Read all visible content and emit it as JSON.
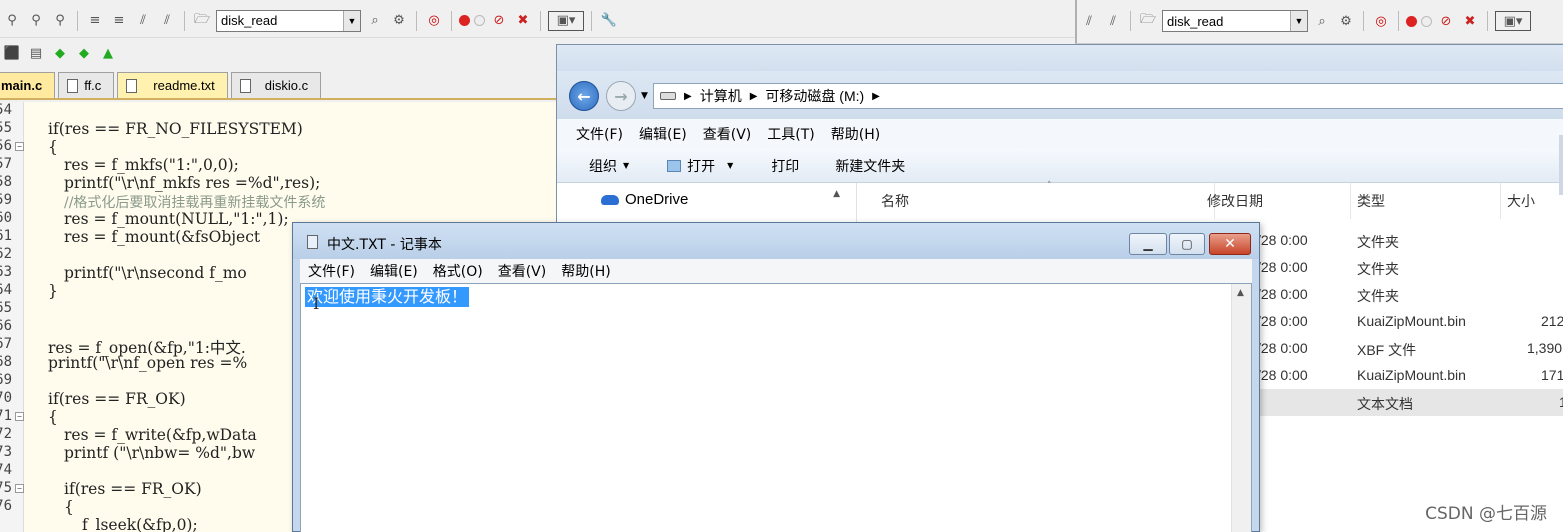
{
  "ide": {
    "toolbar": {
      "target_name": "disk_read"
    },
    "tabs": [
      {
        "label": "main.c"
      },
      {
        "label": "ff.c"
      },
      {
        "label": "readme.txt"
      },
      {
        "label": "diskio.c"
      }
    ],
    "gutter_numbers": [
      "54",
      "55",
      "56",
      "57",
      "58",
      "59",
      "60",
      "61",
      "62",
      "63",
      "64",
      "65",
      "66",
      "67",
      "68",
      "69",
      "70",
      "71",
      "72",
      "73",
      "74",
      "75",
      "76"
    ],
    "code_lines": [
      "if(res == FR_NO_FILESYSTEM)",
      "{",
      "res = f_mkfs(\"1:\",0,0);",
      "printf(\"\\r\\nf_mkfs res =%d\",res);",
      "//格式化后要取消挂载再重新挂载文件系统",
      "res = f_mount(NULL,\"1:\",1);",
      "res = f_mount(&fsObject",
      "printf(\"\\r\\nsecond f_mo",
      "}",
      "res = f_open(&fp,\"1:中文.",
      "printf(\"\\r\\nf_open res =%",
      "if(res == FR_OK)",
      "{",
      "res = f_write(&fp,wData",
      "printf (\"\\r\\nbw= %d\",bw",
      "if(res == FR_OK)",
      "{",
      "f_lseek(&fp,0);"
    ]
  },
  "ide2": {
    "target_name": "disk_read"
  },
  "explorer": {
    "breadcrumb": [
      "计算机",
      "可移动磁盘 (M:)"
    ],
    "menu": [
      "文件(F)",
      "编辑(E)",
      "查看(V)",
      "工具(T)",
      "帮助(H)"
    ],
    "commands": {
      "organize": "组织",
      "open": "打开",
      "print": "打印",
      "new_folder": "新建文件夹"
    },
    "nav": {
      "onedrive": "OneDrive"
    },
    "columns": {
      "name": "名称",
      "date": "修改日期",
      "type": "类型",
      "size": "大小"
    },
    "files": [
      {
        "date": "/28 0:00",
        "type": "文件夹",
        "size": ""
      },
      {
        "date": "/28 0:00",
        "type": "文件夹",
        "size": ""
      },
      {
        "date": "/28 0:00",
        "type": "文件夹",
        "size": ""
      },
      {
        "date": "/28 0:00",
        "type": "KuaiZipMount.bin",
        "size": "212"
      },
      {
        "date": "/28 0:00",
        "type": "XBF 文件",
        "size": "1,390"
      },
      {
        "date": "/28 0:00",
        "type": "KuaiZipMount.bin",
        "size": "171"
      },
      {
        "date": "",
        "type": "文本文档",
        "size": "1"
      }
    ]
  },
  "notepad": {
    "title": "中文.TXT - 记事本",
    "menu": [
      "文件(F)",
      "编辑(E)",
      "格式(O)",
      "查看(V)",
      "帮助(H)"
    ],
    "content": "欢迎使用秉火开发板！"
  },
  "watermark": "CSDN @七百源",
  "colors": {
    "selection": "#3399ff",
    "close_button": "#c7442a",
    "code_bg": "#fffcee",
    "keyword": "#8b1a1a"
  }
}
